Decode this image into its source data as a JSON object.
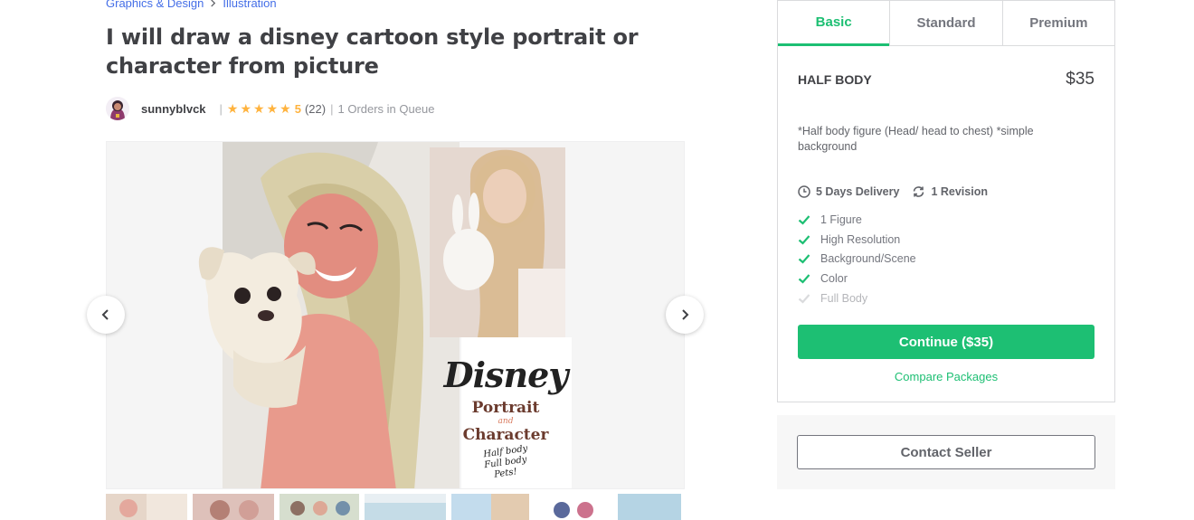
{
  "breadcrumb": {
    "category": "Graphics & Design",
    "subcategory": "Illustration"
  },
  "gig": {
    "title": "I will draw a disney cartoon style portrait or character from picture"
  },
  "seller": {
    "username": "sunnyblvck",
    "rating_value": "5",
    "rating_stars": 5,
    "reviews": "(22)",
    "queue": "1 Orders in Queue"
  },
  "gallery": {
    "image_text": {
      "brand": "Disney",
      "line1": "Portrait",
      "and": "and",
      "line2": "Character",
      "note1": "Half body",
      "note2": "Full body",
      "note3": "Pets!"
    }
  },
  "packages": {
    "tabs": [
      {
        "label": "Basic",
        "active": true
      },
      {
        "label": "Standard",
        "active": false
      },
      {
        "label": "Premium",
        "active": false
      }
    ],
    "selected": {
      "name": "HALF BODY",
      "price": "$35",
      "description": "*Half body figure (Head/ head to chest) *simple background",
      "delivery": "5 Days Delivery",
      "revisions": "1 Revision",
      "features": [
        {
          "label": "1 Figure",
          "included": true
        },
        {
          "label": "High Resolution",
          "included": true
        },
        {
          "label": "Background/Scene",
          "included": true
        },
        {
          "label": "Color",
          "included": true
        },
        {
          "label": "Full Body",
          "included": false
        }
      ],
      "continue_label": "Continue ($35)",
      "compare_label": "Compare Packages"
    }
  },
  "contact": {
    "label": "Contact Seller"
  },
  "colors": {
    "accent": "#1dbf73",
    "link": "#446ee7",
    "star": "#ffb33e",
    "text": "#404145"
  }
}
